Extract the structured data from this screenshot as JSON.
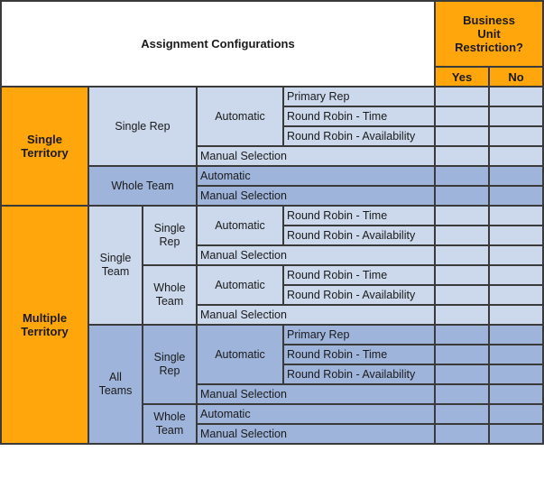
{
  "header": {
    "title": "Assignment Configurations",
    "restriction": "Business\nUnit\nRestriction?",
    "yes": "Yes",
    "no": "No"
  },
  "colors": {
    "orange": "#ffa60d",
    "light_blue": "#ccd9ec",
    "mid_blue": "#9fb4db",
    "border": "#3a3a3a"
  },
  "territories": {
    "single": "Single\nTerritory",
    "multiple": "Multiple\nTerritory"
  },
  "single_territory": {
    "single_rep": "Single Rep",
    "whole_team": "Whole Team",
    "automatic": "Automatic",
    "primary_rep": "Primary Rep",
    "rr_time": "Round Robin - Time",
    "rr_avail": "Round Robin - Availability",
    "manual": "Manual Selection",
    "wt_automatic": "Automatic",
    "wt_manual": "Manual Selection"
  },
  "multiple_territory": {
    "single_team": "Single\nTeam",
    "all_teams": "All\nTeams",
    "st_single_rep": "Single\nRep",
    "st_sr_automatic": "Automatic",
    "st_sr_rr_time": "Round Robin - Time",
    "st_sr_rr_avail": "Round Robin - Availability",
    "st_sr_manual": "Manual Selection",
    "st_whole_team": "Whole\nTeam",
    "st_wt_automatic": "Automatic",
    "st_wt_rr_time": "Round Robin - Time",
    "st_wt_rr_avail": "Round Robin - Availability",
    "st_wt_manual": "Manual Selection",
    "at_single_rep": "Single\nRep",
    "at_sr_automatic": "Automatic",
    "at_sr_primary_rep": "Primary Rep",
    "at_sr_rr_time": "Round Robin - Time",
    "at_sr_rr_avail": "Round Robin - Availability",
    "at_sr_manual": "Manual Selection",
    "at_whole_team": "Whole\nTeam",
    "at_wt_automatic": "Automatic",
    "at_wt_manual": "Manual Selection"
  }
}
